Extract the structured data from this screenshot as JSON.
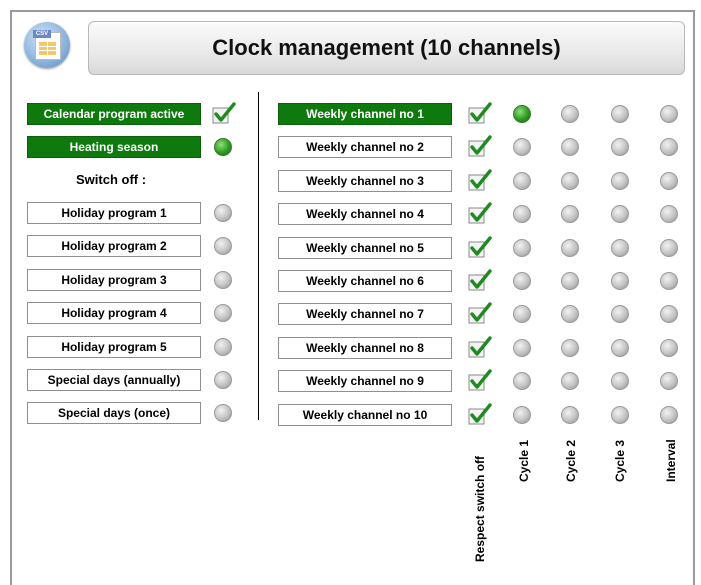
{
  "header": {
    "title": "Clock management (10 channels)",
    "icon": "csv-file-icon",
    "icon_tag": "CSV"
  },
  "left": {
    "calendar_program_active": {
      "label": "Calendar program active",
      "checked": true
    },
    "heating_season": {
      "label": "Heating season",
      "led": "on"
    },
    "switch_off_label": "Switch off :",
    "items": [
      {
        "label": "Holiday program 1",
        "led": "off"
      },
      {
        "label": "Holiday program 2",
        "led": "off"
      },
      {
        "label": "Holiday program 3",
        "led": "off"
      },
      {
        "label": "Holiday program 4",
        "led": "off"
      },
      {
        "label": "Holiday program 5",
        "led": "off"
      },
      {
        "label": "Special days (annually)",
        "led": "off"
      },
      {
        "label": "Special days (once)",
        "led": "off"
      }
    ]
  },
  "channels": [
    {
      "label": "Weekly channel no 1",
      "active": true,
      "respect_switch_off": true,
      "cycle1": "on",
      "cycle2": "off",
      "cycle3": "off",
      "interval": "off"
    },
    {
      "label": "Weekly channel no 2",
      "active": false,
      "respect_switch_off": true,
      "cycle1": "off",
      "cycle2": "off",
      "cycle3": "off",
      "interval": "off"
    },
    {
      "label": "Weekly channel no 3",
      "active": false,
      "respect_switch_off": true,
      "cycle1": "off",
      "cycle2": "off",
      "cycle3": "off",
      "interval": "off"
    },
    {
      "label": "Weekly channel no 4",
      "active": false,
      "respect_switch_off": true,
      "cycle1": "off",
      "cycle2": "off",
      "cycle3": "off",
      "interval": "off"
    },
    {
      "label": "Weekly channel no 5",
      "active": false,
      "respect_switch_off": true,
      "cycle1": "off",
      "cycle2": "off",
      "cycle3": "off",
      "interval": "off"
    },
    {
      "label": "Weekly channel no 6",
      "active": false,
      "respect_switch_off": true,
      "cycle1": "off",
      "cycle2": "off",
      "cycle3": "off",
      "interval": "off"
    },
    {
      "label": "Weekly channel no 7",
      "active": false,
      "respect_switch_off": true,
      "cycle1": "off",
      "cycle2": "off",
      "cycle3": "off",
      "interval": "off"
    },
    {
      "label": "Weekly channel no 8",
      "active": false,
      "respect_switch_off": true,
      "cycle1": "off",
      "cycle2": "off",
      "cycle3": "off",
      "interval": "off"
    },
    {
      "label": "Weekly channel no 9",
      "active": false,
      "respect_switch_off": true,
      "cycle1": "off",
      "cycle2": "off",
      "cycle3": "off",
      "interval": "off"
    },
    {
      "label": "Weekly channel no 10",
      "active": false,
      "respect_switch_off": true,
      "cycle1": "off",
      "cycle2": "off",
      "cycle3": "off",
      "interval": "off"
    }
  ],
  "column_headers": {
    "respect_switch_off": "Respect switch off",
    "cycle1": "Cycle 1",
    "cycle2": "Cycle 2",
    "cycle3": "Cycle 3",
    "interval": "Interval"
  },
  "colors": {
    "active_green": "#0e7a0e",
    "check_green": "#1f8a1f",
    "led_on": "#2f9a22",
    "led_off": "#c3c3c3"
  }
}
